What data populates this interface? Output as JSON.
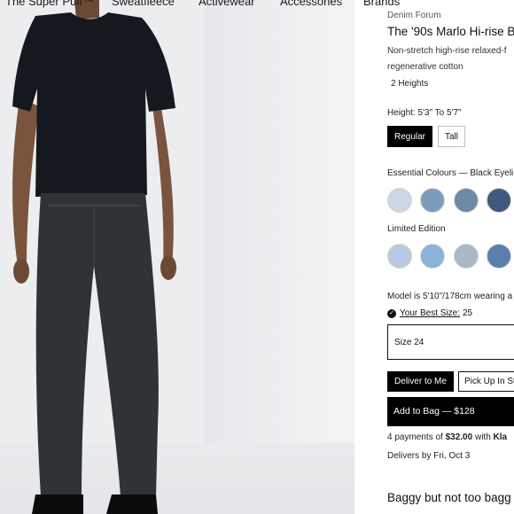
{
  "nav": {
    "items": [
      "The Super Puff™",
      "Sweatfleece",
      "Activewear",
      "Accessories",
      "Brands"
    ]
  },
  "product": {
    "brand": "Denim Forum",
    "title": "The '90s Marlo Hi-rise B",
    "description_line1": "Non-stretch high-rise relaxed-f",
    "description_line2": "regenerative cotton",
    "heights_chip": "2 Heights",
    "height_label": "Height: 5'3\" To 5'7\"",
    "size_options": [
      "Regular",
      "Tall"
    ],
    "selected_size_option": "Regular",
    "essential_colours_label": "Essential Colours — Black Eyeli",
    "essential_colours": [
      "#c9d7e4",
      "#7d9cbb",
      "#6e8aa6",
      "#3f5a7d",
      "#2f3d4e"
    ],
    "limited_edition_label": "Limited Edition",
    "limited_colours": [
      "#b6cbe0",
      "#8bb2d8",
      "#a9b8c6",
      "#5a7fae"
    ],
    "model_info": "Model is 5'10\"/178cm wearing a",
    "best_size_label": "Your Best Size:",
    "best_size_value": "25",
    "size_select_value": "Size 24",
    "deliver_button": "Deliver to Me",
    "pickup_button": "Pick Up In St",
    "add_to_bag_button": "Add to Bag — $128",
    "payments_prefix": "4 payments of ",
    "payments_amount": "$32.00",
    "payments_suffix": " with ",
    "payments_provider": "Kla",
    "delivery_date": "Delivers by Fri, Oct 3",
    "tagline": "Baggy but not too bagg"
  }
}
